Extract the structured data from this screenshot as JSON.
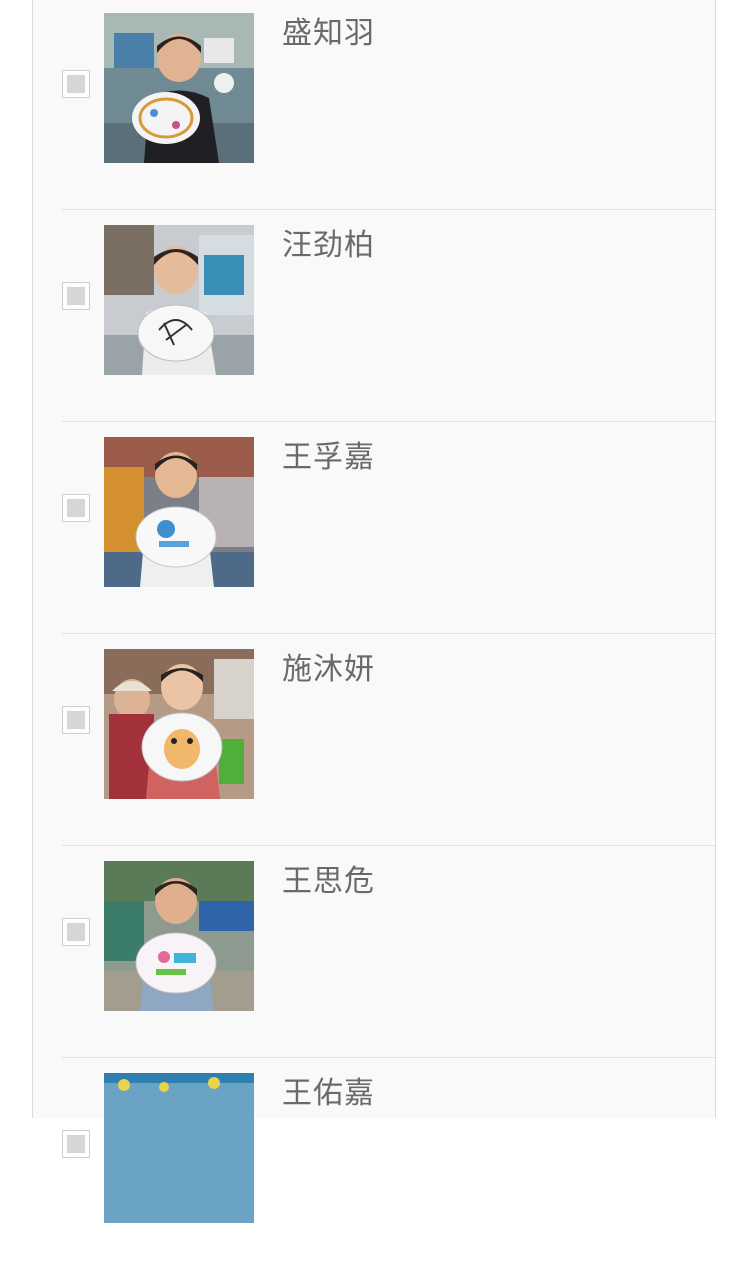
{
  "list": {
    "items": [
      {
        "name": "盛知羽",
        "checked": false,
        "photo_icon": "child-with-painted-plate-photo"
      },
      {
        "name": "汪劲柏",
        "checked": false,
        "photo_icon": "child-with-painted-plate-photo"
      },
      {
        "name": "王孚嘉",
        "checked": false,
        "photo_icon": "child-with-painted-plate-photo"
      },
      {
        "name": "施沐妍",
        "checked": false,
        "photo_icon": "child-with-painted-plate-photo"
      },
      {
        "name": "王思危",
        "checked": false,
        "photo_icon": "child-with-painted-plate-photo"
      },
      {
        "name": "王佑嘉",
        "checked": false,
        "photo_icon": "child-with-painted-plate-photo"
      }
    ]
  },
  "colors": {
    "panel_bg": "#f9f9f9",
    "divider": "#e3e3e3",
    "name_text": "#6a6a6a",
    "checkbox_fill": "#d6d6d6"
  }
}
